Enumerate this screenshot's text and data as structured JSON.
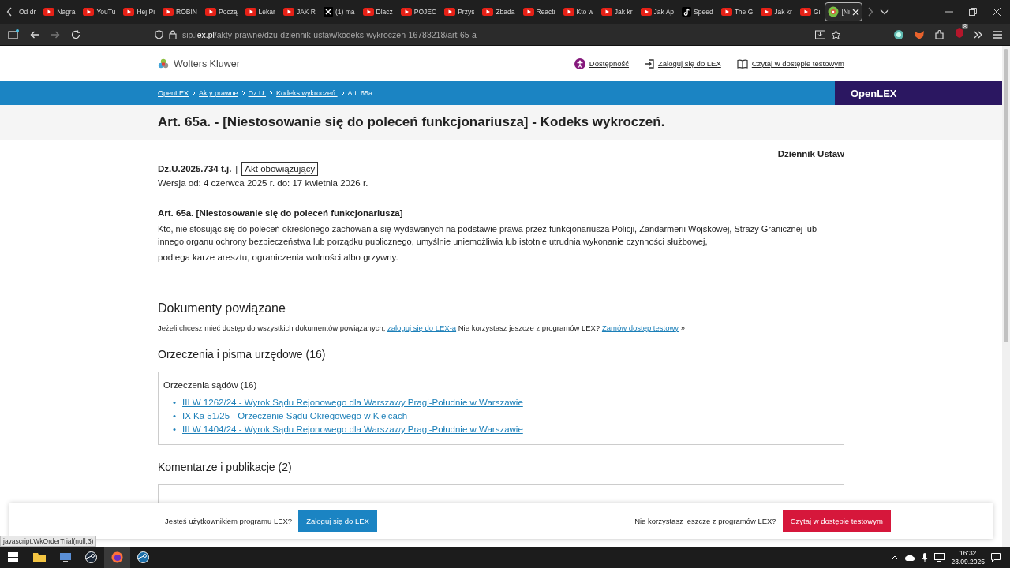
{
  "browser": {
    "tabs": [
      {
        "label": "Od dr",
        "kind": "none",
        "selected": false
      },
      {
        "label": "Nagra",
        "kind": "youtube",
        "selected": false
      },
      {
        "label": "YouTu",
        "kind": "youtube",
        "selected": false
      },
      {
        "label": "Hej Pi",
        "kind": "youtube",
        "selected": false
      },
      {
        "label": "ROBIN",
        "kind": "youtube",
        "selected": false
      },
      {
        "label": "Począ",
        "kind": "youtube",
        "selected": false
      },
      {
        "label": "Lekar",
        "kind": "youtube",
        "selected": false
      },
      {
        "label": "JAK R",
        "kind": "youtube",
        "selected": false
      },
      {
        "label": "(1) ma",
        "kind": "x",
        "selected": false
      },
      {
        "label": "Dlacz",
        "kind": "youtube",
        "selected": false
      },
      {
        "label": "POJEC",
        "kind": "youtube",
        "selected": false
      },
      {
        "label": "Przys",
        "kind": "youtube",
        "selected": false
      },
      {
        "label": "Zbada",
        "kind": "youtube",
        "selected": false
      },
      {
        "label": "Reacti",
        "kind": "youtube",
        "selected": false
      },
      {
        "label": "Kto w",
        "kind": "youtube",
        "selected": false
      },
      {
        "label": "Jak kr",
        "kind": "youtube",
        "selected": false
      },
      {
        "label": "Jak Ap",
        "kind": "youtube",
        "selected": false
      },
      {
        "label": "Speed",
        "kind": "tiktok",
        "selected": false
      },
      {
        "label": "The G",
        "kind": "youtube",
        "selected": false
      },
      {
        "label": "Jak kr",
        "kind": "youtube",
        "selected": false
      },
      {
        "label": "Gi",
        "kind": "youtube",
        "selected": false
      },
      {
        "label": "[Ni",
        "kind": "site",
        "selected": true
      }
    ],
    "url": "sip.**lex.pl**/akty-prawne/dzu-dziennik-ustaw/kodeks-wykroczen-16788218/art-65-a",
    "extension_badge": "8"
  },
  "site_header": {
    "logo": "Wolters Kluwer",
    "links": [
      {
        "label": "Dostępność",
        "kind": "accessibility"
      },
      {
        "label": "Zaloguj się do LEX",
        "kind": "login"
      },
      {
        "label": "Czytaj w dostępie testowym",
        "kind": "book"
      }
    ]
  },
  "breadcrumb": [
    {
      "label": "OpenLEX",
      "link": true
    },
    {
      "label": "Akty prawne",
      "link": true
    },
    {
      "label": "Dz.U.",
      "link": true
    },
    {
      "label": "Kodeks wykroczeń.",
      "link": true
    },
    {
      "label": "Art. 65a.",
      "link": false
    }
  ],
  "brand": "OpenLEX",
  "title": "Art. 65a. - [Niestosowanie się do poleceń funkcjonariusza] - Kodeks wykroczeń.",
  "document": {
    "journal": "Dziennik Ustaw",
    "reference": "Dz.U.2025.734 t.j.",
    "separator": "|",
    "status": "Akt obowiązujący",
    "version": "Wersja od: 4 czerwca 2025 r. do: 17 kwietnia 2026 r."
  },
  "article": {
    "heading": "Art.  65a. [Niestosowanie się do poleceń funkcjonariusza]",
    "paragraphs": [
      " Kto, nie stosując się do poleceń określonego zachowania się wydawanych na podstawie prawa przez funkcjonariusza Policji, Żandarmerii Wojskowej, Straży Granicznej lub innego organu ochrony bezpieczeństwa lub porządku publicznego, umyślnie uniemożliwia lub istotnie utrudnia wykonanie czynności służbowej,",
      "podlega karze aresztu, ograniczenia wolności albo grzywny."
    ]
  },
  "related": {
    "heading": "Dokumenty powiązane",
    "notice": [
      {
        "kind": "text",
        "text": "Jeżeli chcesz mieć dostęp do wszystkich dokumentów powiązanych,"
      },
      {
        "kind": "link",
        "text": "zaloguj się do LEX-a"
      },
      {
        "kind": "text",
        "text": "Nie korzystasz jeszcze z programów LEX?"
      },
      {
        "kind": "link",
        "text": "Zamów dostęp testowy"
      },
      {
        "kind": "text",
        "text": "»"
      }
    ],
    "sections": [
      {
        "heading": "Orzeczenia i pisma urzędowe (16)",
        "box_title": "Orzeczenia sądów (16)",
        "bullet": "•",
        "links": [
          "III W 1262/24 - Wyrok Sądu Rejonowego dla Warszawy Pragi-Południe w Warszawie",
          "IX Ka 51/25 - Orzeczenie Sądu Okręgowego w Kielcach",
          "III W 1404/24 - Wyrok Sądu Rejonowego dla Warszawy Pragi-Południe w Warszawie"
        ]
      },
      {
        "heading": "Komentarze i publikacje (2)"
      }
    ]
  },
  "banner": [
    {
      "text": "Jesteś użytkownikiem programu LEX?",
      "button": "Zaloguj się do LEX",
      "kind": "login"
    },
    {
      "text": "Nie korzystasz jeszcze z programów LEX?",
      "button": "Czytaj w dostępie testowym",
      "kind": "trial"
    }
  ],
  "status_tooltip": "javascript:WkOrderTrial(null,3)",
  "taskbar": {
    "time": "16:32",
    "date": "23.09.2025"
  }
}
